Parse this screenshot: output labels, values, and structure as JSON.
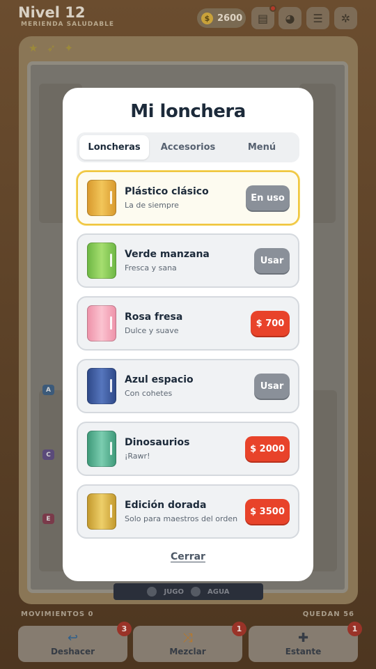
{
  "header": {
    "level_title": "Nivel 12",
    "level_subtitle": "MERIENDA SALUDABLE",
    "coins": "2600"
  },
  "legend": {
    "juice": "JUGO",
    "water": "AGUA"
  },
  "status": {
    "moves": "MOVIMIENTOS 0",
    "remaining": "QUEDAN 56"
  },
  "actions": [
    {
      "label": "Deshacer",
      "badge": "3",
      "icon": "undo-icon"
    },
    {
      "label": "Mezclar",
      "badge": "1",
      "icon": "shuffle-icon"
    },
    {
      "label": "Estante",
      "badge": "1",
      "icon": "plus-icon"
    }
  ],
  "shelf_tags": [
    "A",
    "C",
    "E"
  ],
  "modal": {
    "title": "Mi lonchera",
    "tabs": [
      "Loncheras",
      "Accesorios",
      "Menú"
    ],
    "items": [
      {
        "name": "Plástico clásico",
        "desc": "La de siempre",
        "button": "En uso",
        "color": "#e8b84a"
      },
      {
        "name": "Verde manzana",
        "desc": "Fresca y sana",
        "button": "Usar",
        "color": "#8fcf5a"
      },
      {
        "name": "Rosa fresa",
        "desc": "Dulce y suave",
        "button": "$ 700",
        "color": "#f4a9bb"
      },
      {
        "name": "Azul espacio",
        "desc": "Con cohetes",
        "button": "Usar",
        "color": "#3d5aa0"
      },
      {
        "name": "Dinosaurios",
        "desc": "¡Rawr!",
        "button": "$ 2000",
        "color": "#4fae8c"
      },
      {
        "name": "Edición dorada",
        "desc": "Solo para maestros del orden",
        "button": "$ 3500",
        "color": "#d9b040"
      }
    ],
    "close_label": "Cerrar"
  },
  "colors": {
    "accent_red": "#e8432a",
    "selected_border": "#f0c640",
    "title": "#1c2a3a"
  }
}
